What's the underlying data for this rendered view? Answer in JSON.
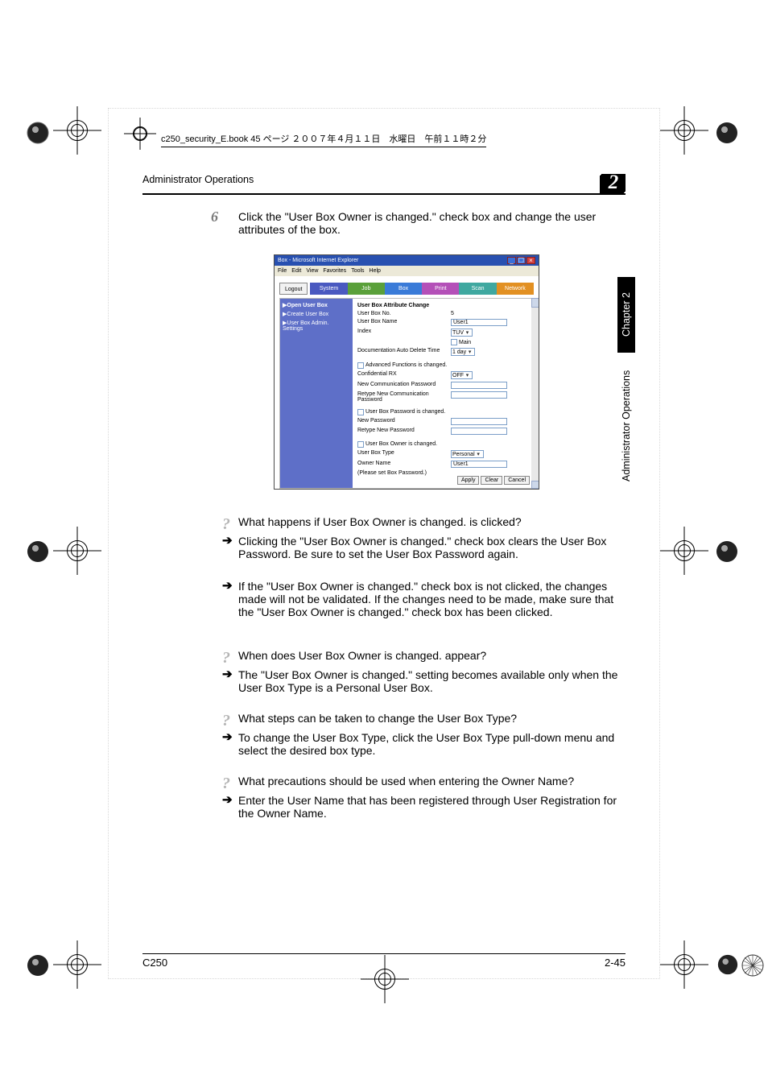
{
  "page": {
    "stamp": "c250_security_E.book  45 ページ  ２００７年４月１１日　水曜日　午前１１時２分",
    "header_title": "Administrator Operations",
    "chapter_number": "2",
    "footer_left": "C250",
    "footer_right": "2-45",
    "sidebar_chapter": "Chapter 2",
    "sidebar_section": "Administrator Operations"
  },
  "step": {
    "number": "6",
    "text": "Click the \"User Box Owner is changed.\" check box and change the user attributes of the box."
  },
  "screenshot": {
    "window_title": "Box - Microsoft Internet Explorer",
    "menubar": [
      "File",
      "Edit",
      "View",
      "Favorites",
      "Tools",
      "Help"
    ],
    "logout": "Logout",
    "tabs": {
      "system": "System",
      "job": "Job",
      "box": "Box",
      "print": "Print",
      "scan": "Scan",
      "network": "Network"
    },
    "side": {
      "open": "▶Open User Box",
      "create": "▶Create User Box",
      "admin": "▶User Box Admin. Settings"
    },
    "main": {
      "title": "User Box Attribute Change",
      "userbox_no_label": "User Box No.",
      "userbox_no": "5",
      "userbox_name_label": "User Box Name",
      "userbox_name": "User1",
      "index_label": "Index",
      "index": "TUV",
      "main_chk": "Main",
      "autodel_label": "Documentation Auto Delete Time",
      "autodel": "1 day",
      "adv_chk": "Advanced Functions is changed.",
      "conf_label": "Confidential RX",
      "conf": "OFF",
      "newcomm_label": "New Communication Password",
      "retypecomm_label": "Retype New Communication Password",
      "pw_chk": "User Box Password is changed.",
      "newpw_label": "New Password",
      "retypepw_label": "Retype New Password",
      "owner_chk": "User Box Owner is changed.",
      "type_label": "User Box Type",
      "type": "Personal",
      "ownername_label": "Owner Name",
      "ownername": "User1",
      "ownernote": "(Please set Box Password.)",
      "btn_apply": "Apply",
      "btn_clear": "Clear",
      "btn_cancel": "Cancel"
    }
  },
  "qa": [
    {
      "q": "What happens if User Box Owner is changed. is clicked?",
      "a": "Clicking the \"User Box Owner is changed.\" check box clears the User Box Password. Be sure to set the User Box Password again."
    },
    {
      "a": "If the \"User Box Owner is changed.\" check box is not clicked, the changes made will not be validated. If the changes need to be made, make sure that the \"User Box Owner is changed.\" check box has been clicked."
    },
    {
      "q": "When does User Box Owner is changed. appear?",
      "a": "The \"User Box Owner is changed.\" setting becomes available only when the User Box Type is a Personal User Box."
    },
    {
      "q": "What steps can be taken to change the User Box Type?",
      "a": "To change the User Box Type, click the User Box Type pull-down menu and select the desired box type."
    },
    {
      "q": "What precautions should be used when entering the Owner Name?",
      "a": "Enter the User Name that has been registered through User Registration for the Owner Name."
    }
  ]
}
